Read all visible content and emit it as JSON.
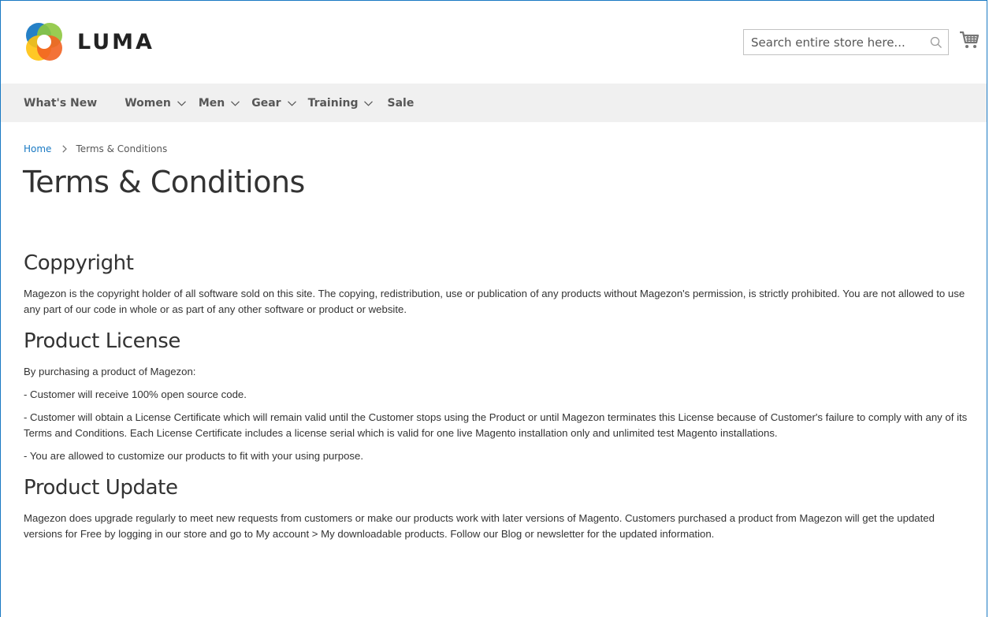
{
  "header": {
    "logo_text": "LUMA",
    "search": {
      "placeholder": "Search entire store here..."
    }
  },
  "nav": {
    "items": [
      {
        "label": "What's New",
        "has_dropdown": false
      },
      {
        "label": "Women",
        "has_dropdown": true
      },
      {
        "label": "Men",
        "has_dropdown": true
      },
      {
        "label": "Gear",
        "has_dropdown": true
      },
      {
        "label": "Training",
        "has_dropdown": true
      },
      {
        "label": "Sale",
        "has_dropdown": false
      }
    ]
  },
  "breadcrumb": {
    "home": "Home",
    "current": "Terms & Conditions"
  },
  "page": {
    "title": "Terms & Conditions"
  },
  "sections": {
    "copyright": {
      "heading": "Coppyright",
      "body": "Magezon is the copyright holder of all software sold on this site. The copying, redistribution, use or publication of any products without Magezon's permission, is strictly prohibited. You are not allowed to use any part of our code in whole or as part of any other software or product or website."
    },
    "license": {
      "heading": "Product License",
      "intro": "By purchasing a product of Magezon:",
      "item1": "- Customer will receive 100% open source code.",
      "item2": "- Customer will obtain a License Certificate which will remain valid until the Customer stops using the Product or until Magezon terminates this License because of Customer's failure to comply with any of its Terms and Conditions. Each License Certificate includes a license serial which is valid for one live Magento installation only and unlimited test Magento installations.",
      "item3": "- You are allowed to customize our products to fit with your using purpose."
    },
    "update": {
      "heading": "Product Update",
      "body": "Magezon does upgrade regularly to meet new requests from customers or make our products work with later versions of Magento. Customers purchased a product from Magezon will get the updated versions for Free by logging in our store and go to My account > My downloadable products. Follow our Blog or newsletter for the updated information."
    }
  },
  "colors": {
    "link": "#1979c3",
    "nav_bg": "#f0f0f0",
    "logo_orange": "#f26322",
    "logo_blue": "#1979c3",
    "logo_green": "#8dc63f",
    "logo_yellow": "#ffc20e"
  },
  "icons": {
    "logo": "luma-logo-icon",
    "search": "search-icon",
    "cart": "cart-icon",
    "chevron": "chevron-down-icon",
    "breadcrumb_sep": "chevron-right-icon"
  }
}
